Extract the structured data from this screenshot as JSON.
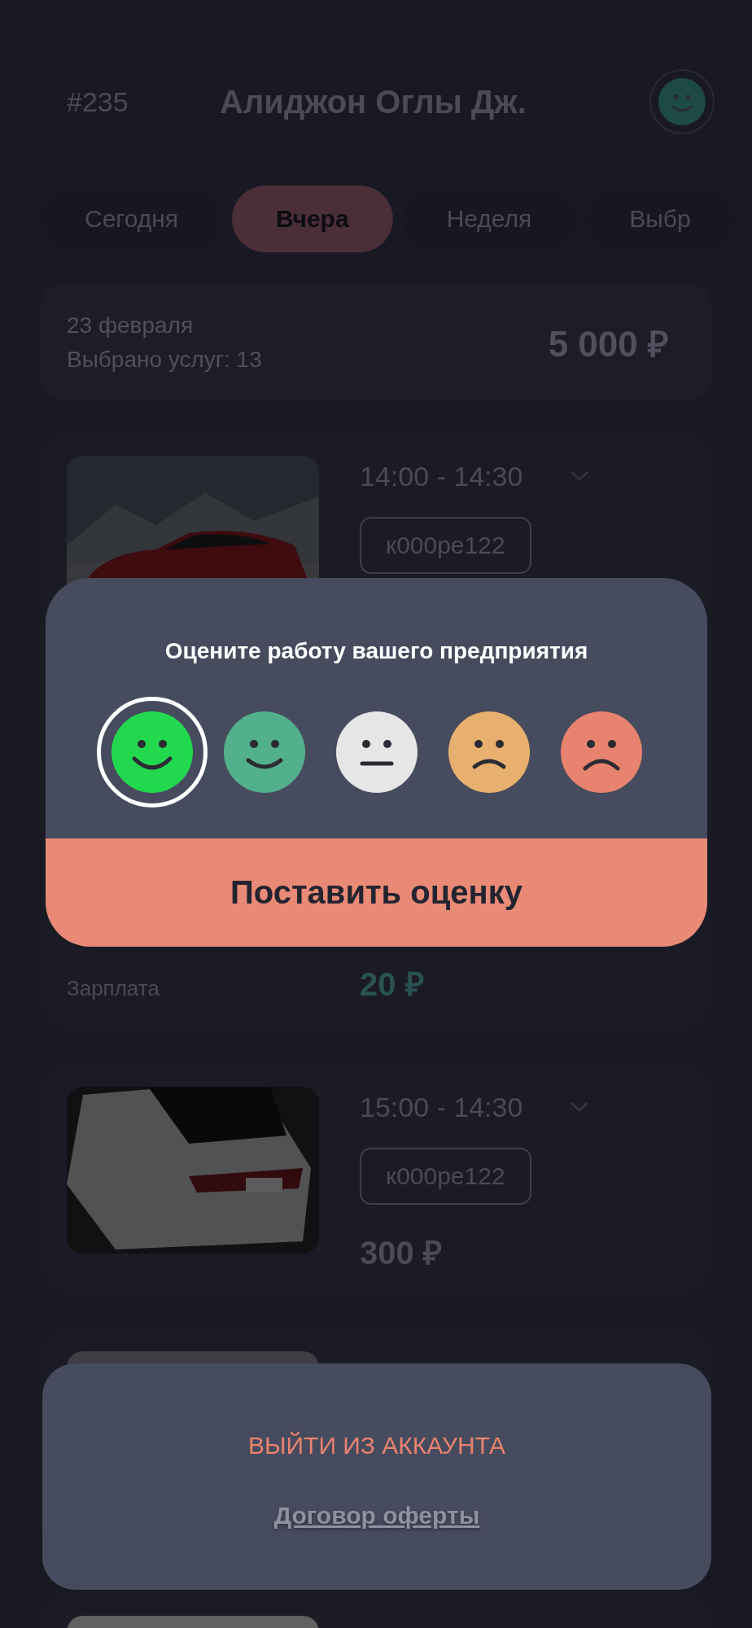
{
  "header": {
    "number": "#235",
    "name": "Алиджон Оглы Дж."
  },
  "tabs": [
    {
      "label": "Сегодня",
      "selected": false
    },
    {
      "label": "Вчера",
      "selected": true
    },
    {
      "label": "Неделя",
      "selected": false
    },
    {
      "label": "Выбр",
      "selected": false
    }
  ],
  "summary": {
    "date": "23 февраля",
    "services": "Выбрано услуг: 13",
    "total": "5 000 ₽"
  },
  "orders": [
    {
      "kind": "picture",
      "time": "14:00 - 14:30",
      "plate": "к000ре122",
      "salary": {
        "label": "Зарплата",
        "amount": "20 ₽"
      }
    },
    {
      "kind": "picture",
      "time": "15:00 - 14:30",
      "plate": "к000ре122",
      "price": "300 ₽"
    },
    {
      "kind": "picture"
    },
    {
      "kind": "picture"
    }
  ],
  "modal": {
    "title": "Оцените работу вашего предприятия",
    "ratings": [
      {
        "kind": "very-happy",
        "color": "#22d84f",
        "selected": true
      },
      {
        "kind": "happy",
        "color": "#52b08c",
        "selected": false
      },
      {
        "kind": "neutral",
        "color": "#e6e6e6",
        "selected": false
      },
      {
        "kind": "sad",
        "color": "#e8b06e",
        "selected": false
      },
      {
        "kind": "very-sad",
        "color": "#e8836f",
        "selected": false
      }
    ],
    "button": "Поставить оценку"
  },
  "sheet": {
    "logout": "ВЫЙТИ ИЗ АККАУНТА",
    "offer_link": "Договор оферты"
  }
}
